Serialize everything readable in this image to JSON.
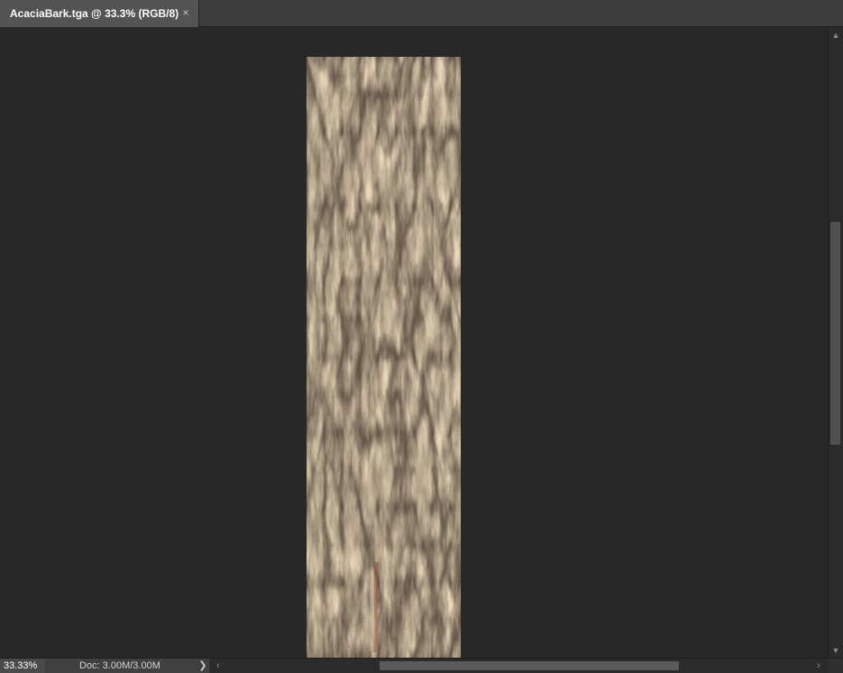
{
  "document": {
    "tab_title": "AcaciaBark.tga @ 33.3% (RGB/8)",
    "close_glyph": "×"
  },
  "status": {
    "zoom": "33.33%",
    "doc_info": "Doc: 3.00M/3.00M",
    "menu_glyph": "❯"
  },
  "scroll": {
    "up_glyph": "▲",
    "down_glyph": "▼",
    "left_glyph": "‹",
    "right_glyph": "›"
  },
  "icons": {
    "close": "close-icon",
    "status_menu": "chevron-right-icon"
  },
  "colors": {
    "workspace": "#282828",
    "tab_active": "#535353",
    "tab_bar": "#3c3c3c",
    "bark_base": "#5a5249"
  }
}
